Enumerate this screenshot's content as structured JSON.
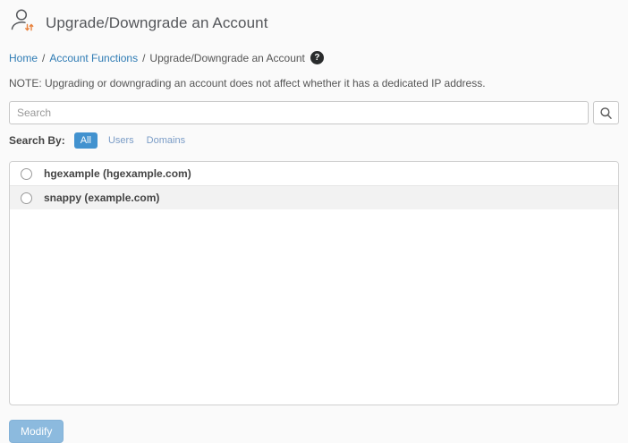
{
  "header": {
    "title": "Upgrade/Downgrade an Account"
  },
  "breadcrumb": {
    "separator": "/",
    "items": [
      {
        "label": "Home"
      },
      {
        "label": "Account Functions"
      },
      {
        "label": "Upgrade/Downgrade an Account"
      }
    ],
    "help_icon_glyph": "?"
  },
  "note": "NOTE: Upgrading or downgrading an account does not affect whether it has a dedicated IP address.",
  "search": {
    "placeholder": "Search",
    "value": ""
  },
  "search_by": {
    "label": "Search By:",
    "options": [
      {
        "label": "All",
        "selected": true
      },
      {
        "label": "Users",
        "selected": false
      },
      {
        "label": "Domains",
        "selected": false
      }
    ]
  },
  "accounts": [
    {
      "label": "hgexample (hgexample.com)",
      "selected": false
    },
    {
      "label": "snappy (example.com)",
      "selected": false
    }
  ],
  "actions": {
    "modify_label": "Modify"
  },
  "colors": {
    "accent_blue": "#4292cf",
    "link_blue": "#2e7bb4",
    "muted_link_blue": "#7a9cc6",
    "modify_button_blue": "#8cbade",
    "icon_arrow_orange": "#e8823d",
    "title_gray": "#54565a"
  }
}
